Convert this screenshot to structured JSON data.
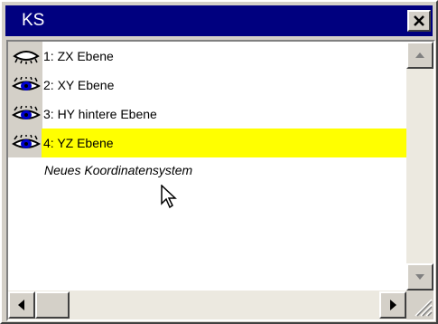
{
  "window": {
    "title": "KS"
  },
  "layers": [
    {
      "label": "1: ZX Ebene",
      "eye": "eye-closed-icon",
      "selected": false
    },
    {
      "label": "2: XY Ebene",
      "eye": "eye-open-icon",
      "selected": false
    },
    {
      "label": "3: HY hintere Ebene",
      "eye": "eye-open-icon",
      "selected": false
    },
    {
      "label": "4: YZ Ebene",
      "eye": "eye-open-icon",
      "selected": true
    }
  ],
  "new_item_label": "Neues Koordinatensystem",
  "colors": {
    "title_bar": "#00007f",
    "selected": "#ffff00",
    "eye_pupil": "#0000cc"
  }
}
